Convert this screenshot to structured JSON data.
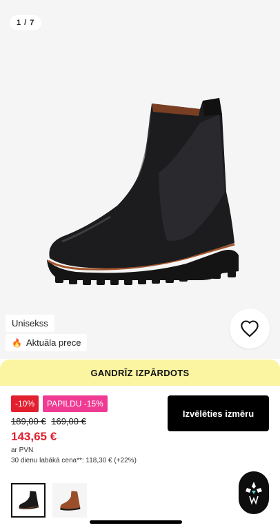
{
  "gallery": {
    "counter": "1 / 7",
    "tags": {
      "unisex": "Unisekss",
      "hot": "Aktuāla prece"
    }
  },
  "banner": {
    "text": "GANDRĪZ IZPĀRDOTS",
    "color": "#fbf4a1"
  },
  "pricing": {
    "badge_discount": "-10%",
    "badge_extra": "PAPILDU -15%",
    "old_price_1": "189,00 €",
    "old_price_2": "169,00 €",
    "current_price": "143,65 €",
    "vat_note": "ar PVN",
    "lowest_price_note": "30 dienu labākā cena**: 118,30 € (+22%)",
    "price_color": "#e2202f",
    "extra_badge_color": "#ef3b93"
  },
  "actions": {
    "select_size": "Izvēlēties izmēru"
  },
  "icons": {
    "wishlist": "heart-outline-icon",
    "fire": "fire-icon",
    "chat": "assistant-logo-icon"
  },
  "thumbnails": [
    {
      "name": "black-boot-thumbnail",
      "selected": true
    },
    {
      "name": "brown-boot-thumbnail",
      "selected": false
    }
  ]
}
